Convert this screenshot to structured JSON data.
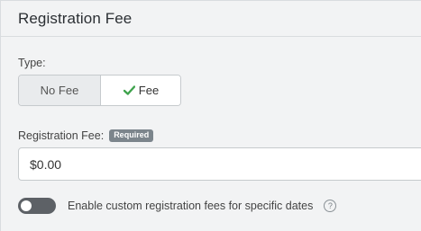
{
  "section": {
    "title": "Registration Fee"
  },
  "type_field": {
    "label": "Type:",
    "options": [
      "No Fee",
      "Fee"
    ],
    "selected": "Fee"
  },
  "fee_field": {
    "label": "Registration Fee:",
    "badge": "Required",
    "value": "$0.00"
  },
  "custom_fees": {
    "toggle_on": false,
    "label": "Enable custom registration fees for specific dates",
    "help_symbol": "?"
  },
  "colors": {
    "check_green": "#3fa34d",
    "toggle_off": "#5d6166",
    "badge_bg": "#7c858c"
  },
  "icons": {
    "check": "check-icon",
    "help": "help-circle-icon"
  }
}
